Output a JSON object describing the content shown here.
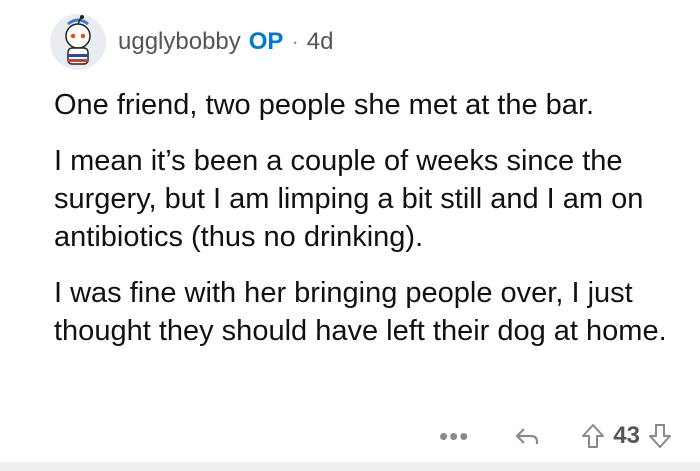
{
  "comment": {
    "author": "ugg​lybobby",
    "op_badge": "OP",
    "separator": "·",
    "age": "4d",
    "paragraphs": [
      "One friend, two people she met at the bar.",
      "I mean it’s been a couple of weeks since the surgery, but I am limping a bit still and I am on antibiotics (thus no drinking).",
      "I was fine with her bringing people over, I just thought they should have left their dog at home."
    ]
  },
  "actions": {
    "more": "•••",
    "vote_count": "43",
    "icons": [
      "reply-icon",
      "upvote-icon",
      "downvote-icon"
    ]
  },
  "colors": {
    "op": "#0079d3",
    "muted": "#878a8c",
    "text": "#111111"
  }
}
